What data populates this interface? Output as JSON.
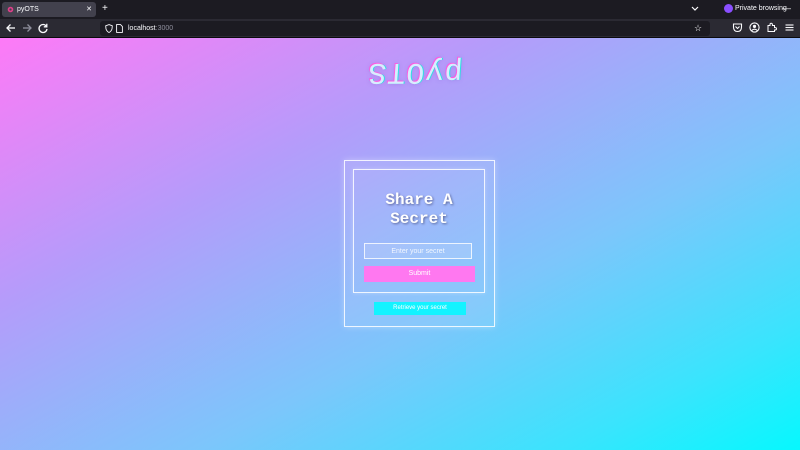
{
  "browser": {
    "tab_title": "pyOTS",
    "new_tab_glyph": "+",
    "close_glyph": "✕",
    "private_label": "Private browsing",
    "minimize_glyph": "—",
    "url_host": "localhost",
    "url_port": ":3000",
    "icons": [
      "back-arrow-icon",
      "forward-arrow-icon",
      "reload-icon",
      "shield-icon",
      "page-icon",
      "star-icon",
      "pocket-icon",
      "account-icon",
      "extensions-icon",
      "tabs-list-icon",
      "private-mask-icon"
    ]
  },
  "page": {
    "logo": "pyOTS",
    "heading": "Share A Secret",
    "secret_placeholder": "Enter your secret",
    "submit_label": "Submit",
    "retrieve_label": "Retrieve your secret",
    "colors": {
      "gradient_start": "#fe7af7",
      "gradient_end": "#06f8fe",
      "submit_bg": "#ff78f0",
      "retrieve_bg": "#13f3ff"
    }
  }
}
